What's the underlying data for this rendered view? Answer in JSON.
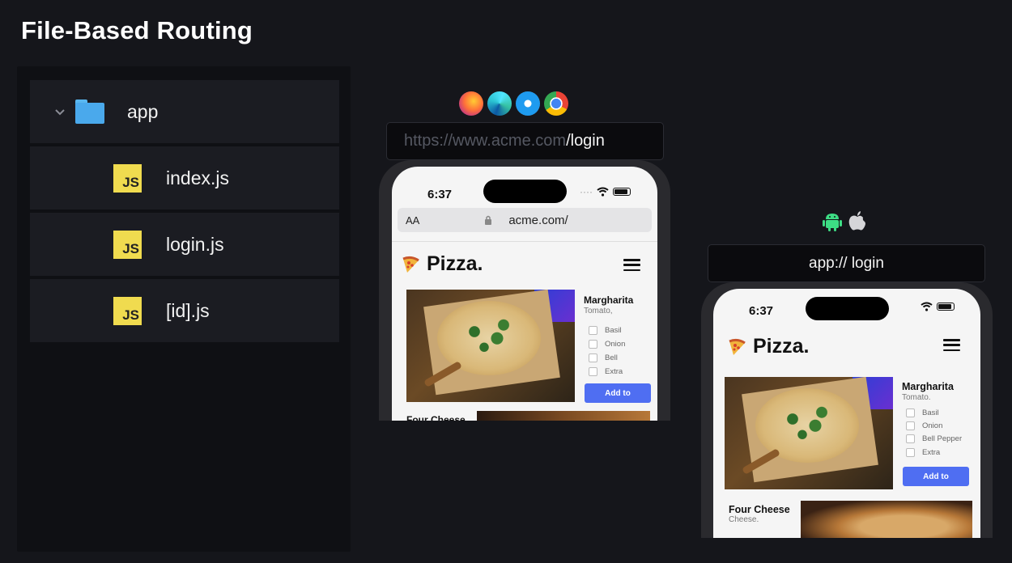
{
  "page_title": "File-Based Routing",
  "file_tree": {
    "folder": {
      "label": "app",
      "icon": "folder-icon"
    },
    "files": [
      {
        "label": "index.js",
        "icon": "js-icon",
        "badge": "JS"
      },
      {
        "label": "login.js",
        "icon": "js-icon",
        "badge": "JS"
      },
      {
        "label": "[id].js",
        "icon": "js-icon",
        "badge": "JS"
      }
    ]
  },
  "browser_icons": [
    "firefox-icon",
    "edge-icon",
    "safari-icon",
    "chrome-icon"
  ],
  "web_url": {
    "base": "https://www.acme.com",
    "path": "/login"
  },
  "os_icons": [
    "android-icon",
    "apple-icon"
  ],
  "app_url": "app:// login",
  "web_phone": {
    "time": "6:37",
    "safari_aa": "AA",
    "address": "acme.com/",
    "brand": "Pizza.",
    "product": {
      "name": "Margharita",
      "desc": "Tomato,",
      "options": [
        "Basil",
        "Onion",
        "Bell",
        "Extra"
      ],
      "button": "Add to"
    },
    "next_product": "Four Cheese"
  },
  "app_phone": {
    "time": "6:37",
    "brand": "Pizza.",
    "product": {
      "name": "Margharita",
      "desc": "Tomato.",
      "options": [
        "Basil",
        "Onion",
        "Bell Pepper",
        "Extra"
      ],
      "button": "Add to"
    },
    "next_product": {
      "name": "Four Cheese",
      "desc": "Cheese."
    }
  },
  "colors": {
    "accent": "#4f6ef2",
    "js_yellow": "#f0db4f",
    "folder_blue": "#4aa9ec"
  }
}
